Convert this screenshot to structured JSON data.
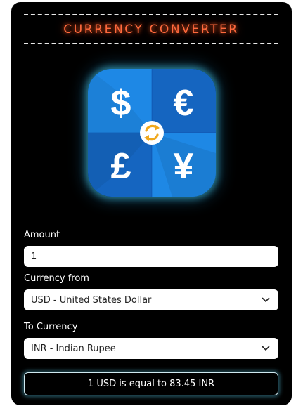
{
  "header": {
    "title": "CURRENCY CONVERTER"
  },
  "logo": {
    "icons": [
      "dollar-icon",
      "euro-icon",
      "pound-icon",
      "yen-icon",
      "swap-icon"
    ],
    "symbols": [
      "$",
      "€",
      "£",
      "¥"
    ],
    "colors": {
      "tile_light": "#1e88e5",
      "tile_dark": "#1565c0",
      "glow": "#46c8e6",
      "swap_arrows": "#f0a81c"
    }
  },
  "form": {
    "amount_label": "Amount",
    "amount_value": "1",
    "from_label": "Currency from",
    "from_value": "USD - United States Dollar",
    "to_label": "To Currency",
    "to_value": "INR - Indian Rupee"
  },
  "result": {
    "text": "1 USD is equal to 83.45 INR"
  },
  "theme": {
    "background": "#000000",
    "title_color": "#ff6a3d"
  }
}
